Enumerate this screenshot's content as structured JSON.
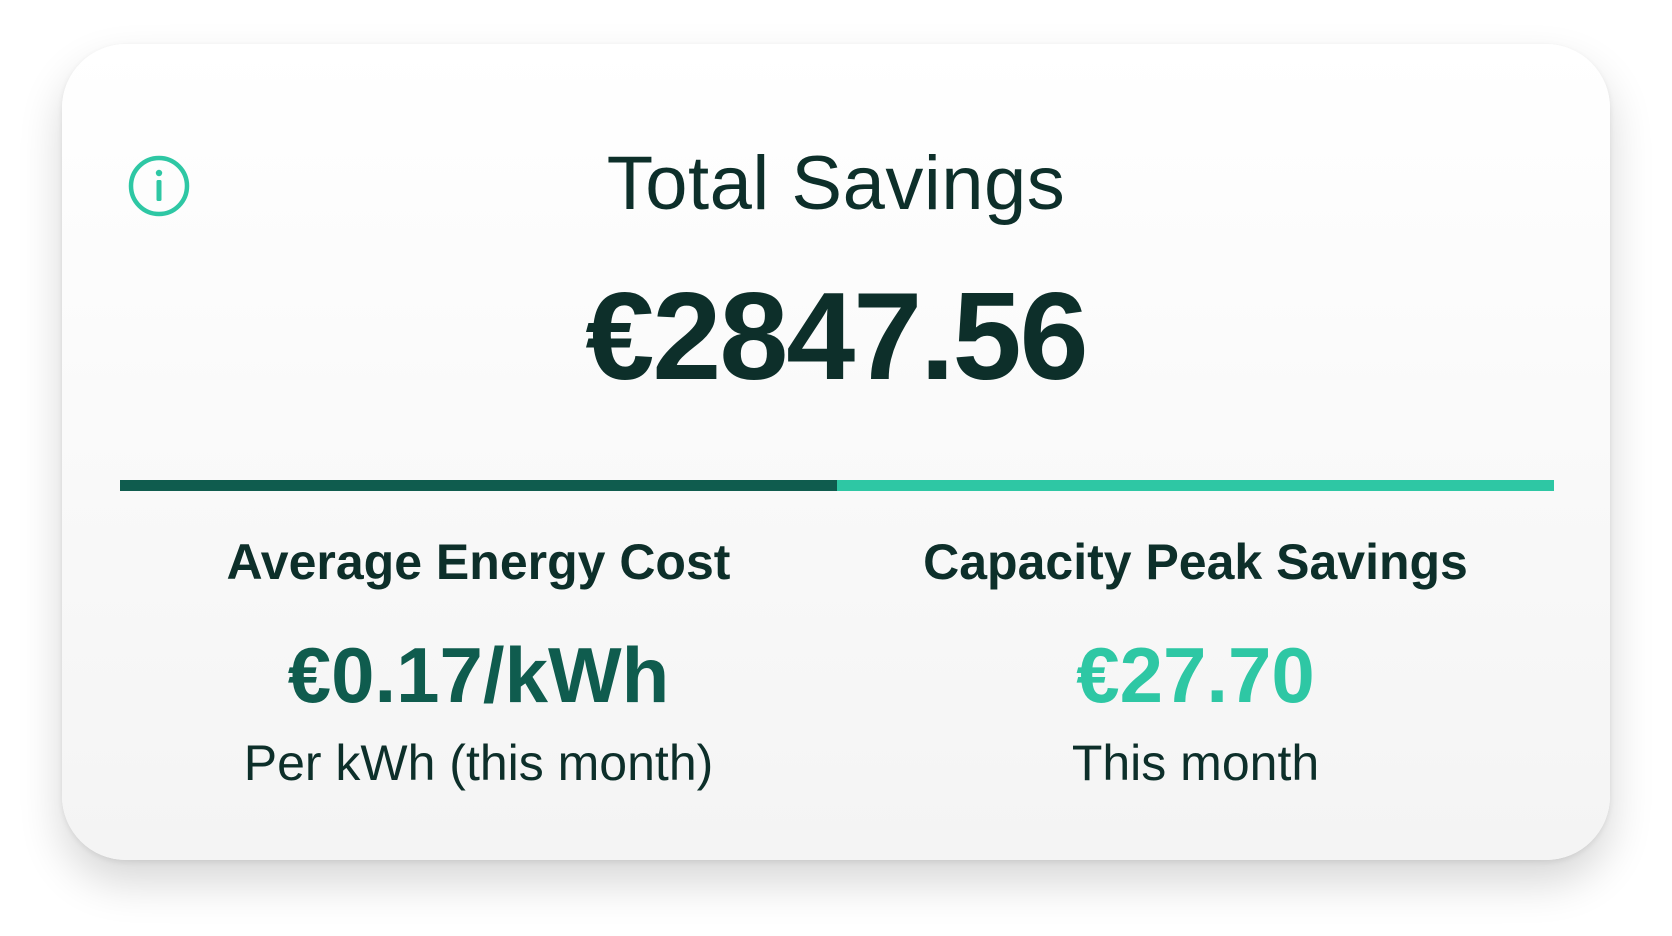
{
  "header": {
    "title": "Total Savings",
    "total_savings": "€2847.56",
    "info_icon": "info-icon"
  },
  "metrics": {
    "avg_energy_cost": {
      "label": "Average Energy Cost",
      "value": "€0.17/kWh",
      "subtitle": "Per kWh (this month)"
    },
    "capacity_peak": {
      "label": "Capacity Peak Savings",
      "value": "€27.70",
      "subtitle": "This month"
    }
  },
  "colors": {
    "dark_text": "#0d2f2a",
    "dark_green": "#0f5c4e",
    "accent_teal": "#2ec7a4"
  }
}
